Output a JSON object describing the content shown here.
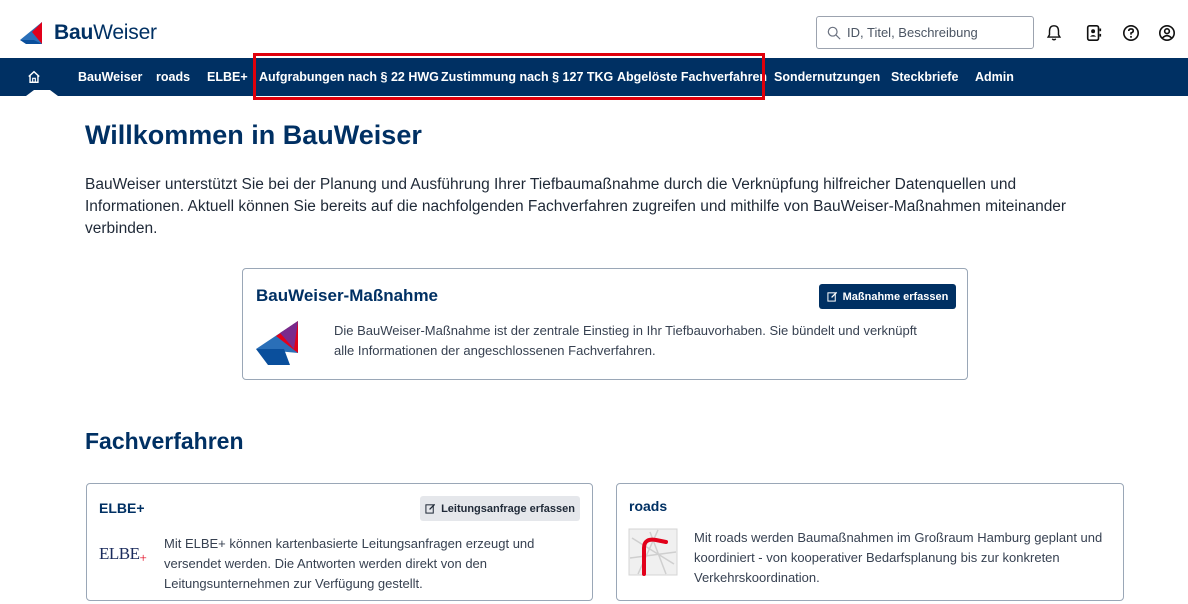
{
  "header": {
    "logo_bold": "Bau",
    "logo_regular": "Weiser",
    "search_placeholder": "ID, Titel, Beschreibung",
    "icons": [
      "bell-icon",
      "contacts-icon",
      "help-icon",
      "account-icon"
    ]
  },
  "nav": {
    "home_icon": "home-icon",
    "items": [
      {
        "label": "BauWeiser"
      },
      {
        "label": "roads"
      },
      {
        "label": "ELBE+"
      },
      {
        "label": "Aufgrabungen nach § 22 HWG"
      },
      {
        "label": "Zustimmung nach § 127 TKG"
      },
      {
        "label": "Abgelöste Fachverfahren"
      },
      {
        "label": "Sondernutzungen"
      },
      {
        "label": "Steckbriefe"
      },
      {
        "label": "Admin"
      }
    ],
    "highlight_color": "#e0000b"
  },
  "main": {
    "title": "Willkommen in BauWeiser",
    "intro": "BauWeiser unterstützt Sie bei der Planung und Ausführung Ihrer Tiefbaumaßnahme durch die Verknüpfung hilfreicher Datenquellen und Informationen. Aktuell können Sie bereits auf die nachfolgenden Fachverfahren zugreifen und mithilfe von BauWeiser-Maßnahmen miteinander verbinden.",
    "massnahme_card": {
      "title": "BauWeiser-Maßnahme",
      "button": "Maßnahme erfassen",
      "text": "Die BauWeiser-Maßnahme ist der zentrale Einstieg in Ihr Tiefbauvorhaben. Sie bündelt und verknüpft alle Informationen der angeschlossenen Fachverfahren."
    },
    "fachverfahren_title": "Fachverfahren",
    "elbe_card": {
      "title": "ELBE+",
      "button": "Leitungsanfrage erfassen",
      "logo_text": "ELBE",
      "text": "Mit ELBE+ können kartenbasierte Leitungsanfragen erzeugt und versendet werden. Die Antworten werden direkt von den Leitungsunternehmen zur Verfügung gestellt."
    },
    "roads_card": {
      "title": "roads",
      "text": "Mit roads werden Baumaßnahmen im Großraum Hamburg geplant und koordiniert - von kooperativer Bedarfsplanung bis zur konkreten Verkehrskoordination."
    }
  },
  "colors": {
    "brand_navy": "#003063",
    "brand_red": "#e2001a",
    "brand_blue": "#0a5ca8"
  }
}
